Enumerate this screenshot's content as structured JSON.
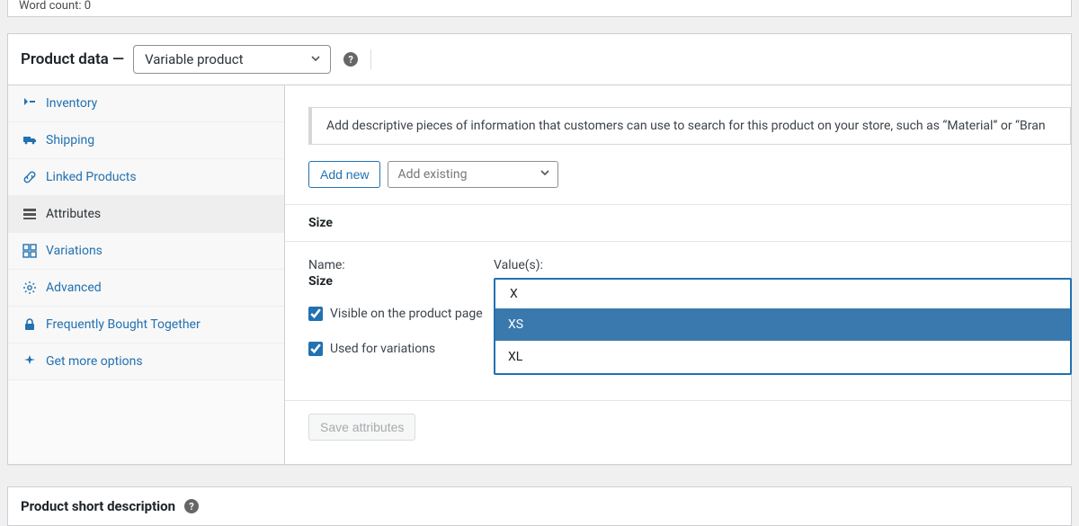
{
  "word_count_label": "Word count: 0",
  "product_data": {
    "header_label": "Product data —",
    "type_selected": "Variable product"
  },
  "tabs": {
    "inventory": "Inventory",
    "shipping": "Shipping",
    "linked_products": "Linked Products",
    "attributes": "Attributes",
    "variations": "Variations",
    "advanced": "Advanced",
    "fbt": "Frequently Bought Together",
    "more": "Get more options"
  },
  "panel": {
    "info_text": "Add descriptive pieces of information that customers can use to search for this product on your store, such as “Material” or “Bran",
    "add_new": "Add new",
    "add_existing_placeholder": "Add existing"
  },
  "attribute": {
    "title": "Size",
    "name_label": "Name:",
    "name_value": "Size",
    "visible_label": "Visible on the product page",
    "used_variations_label": "Used for variations",
    "values_label": "Value(s):",
    "input_value": "X",
    "options": {
      "xs": "XS",
      "xl": "XL"
    }
  },
  "save_attributes_label": "Save attributes",
  "short_desc_title": "Product short description"
}
